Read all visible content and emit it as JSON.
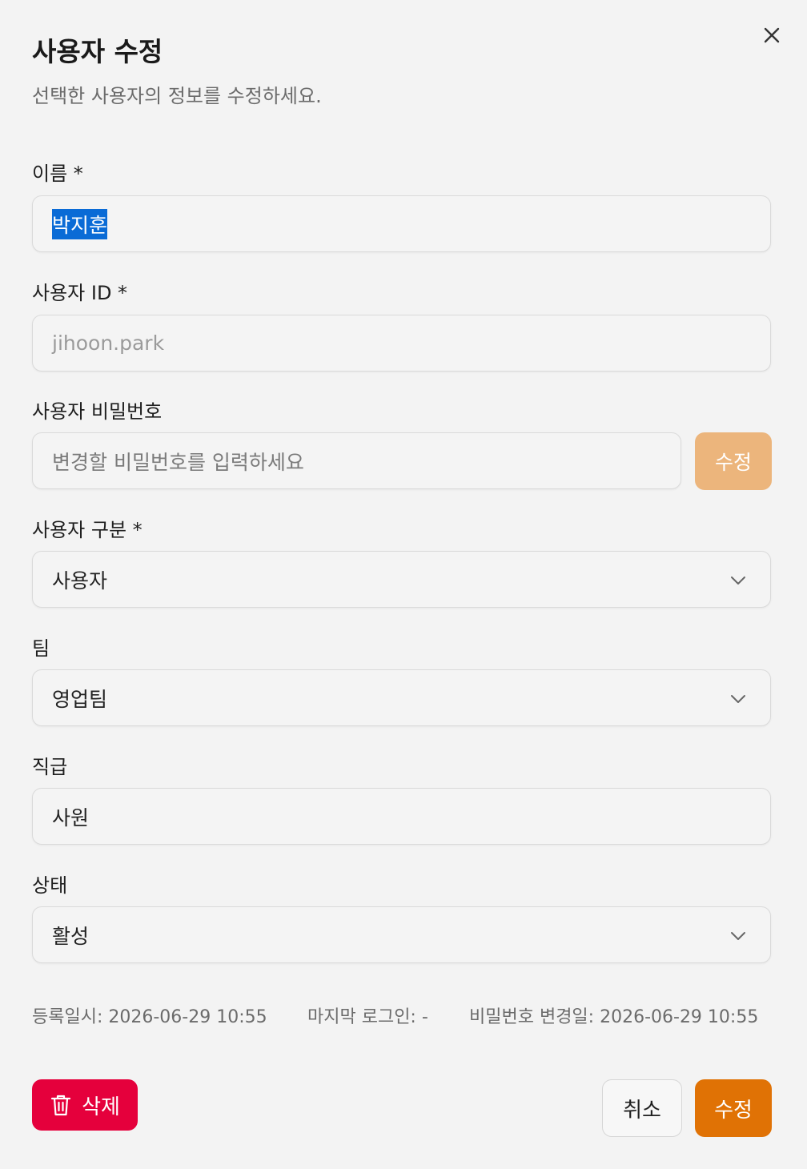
{
  "dialog": {
    "title": "사용자 수정",
    "subtitle": "선택한 사용자의 정보를 수정하세요."
  },
  "fields": {
    "name": {
      "label": "이름 *",
      "value": "박지훈"
    },
    "user_id": {
      "label": "사용자 ID *",
      "value": "jihoon.park"
    },
    "password": {
      "label": "사용자 비밀번호",
      "placeholder": "변경할 비밀번호를 입력하세요",
      "button_label": "수정"
    },
    "user_type": {
      "label": "사용자 구분 *",
      "value": "사용자"
    },
    "team": {
      "label": "팀",
      "value": "영업팀"
    },
    "position": {
      "label": "직급",
      "value": "사원"
    },
    "status": {
      "label": "상태",
      "value": "활성"
    }
  },
  "meta": {
    "registered": "등록일시: 2026-06-29 10:55",
    "last_login": "마지막 로그인: -",
    "password_changed": "비밀번호 변경일: 2026-06-29 10:55"
  },
  "actions": {
    "delete_label": "삭제",
    "cancel_label": "취소",
    "submit_label": "수정"
  },
  "colors": {
    "primary": "#e07205",
    "primary_disabled": "#ecb57c",
    "danger": "#e5003c",
    "selection": "#0a6bd6"
  },
  "icons": {
    "close": "close-icon",
    "chevron": "chevron-down-icon",
    "trash": "trash-icon"
  }
}
